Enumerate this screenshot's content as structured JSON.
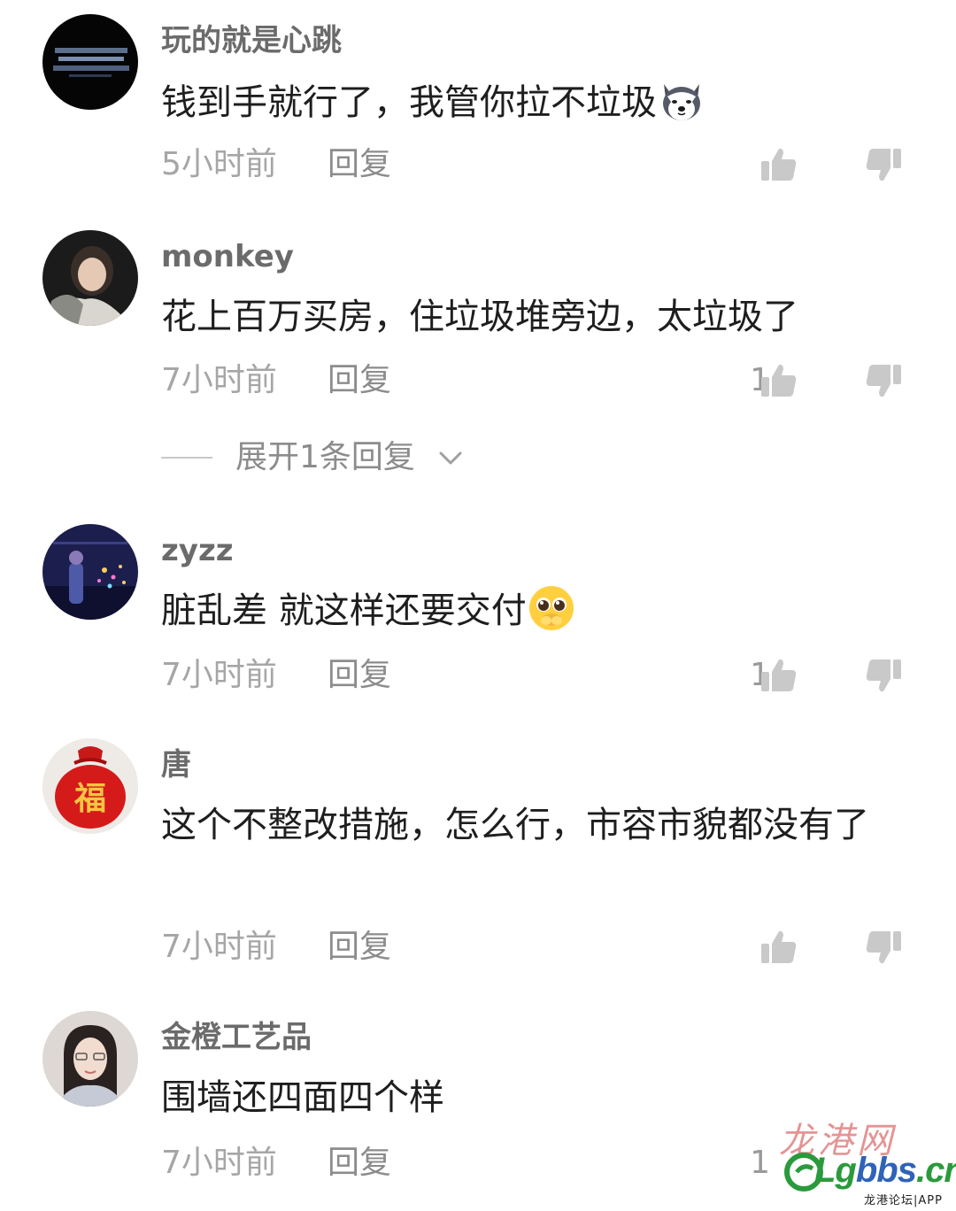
{
  "reply_label": "回复",
  "expand_replies_label": "展开1条回复",
  "comments": [
    {
      "username": "玩的就是心跳",
      "text": "钱到手就行了，我管你拉不垃圾",
      "emoji": "husky-dog-emoji",
      "time": "5小时前",
      "likes": "",
      "avatar": "dark-text-banner-avatar"
    },
    {
      "username": "monkey",
      "text": "花上百万买房，住垃圾堆旁边，太垃圾了",
      "emoji": "",
      "time": "7小时前",
      "likes": "1",
      "avatar": "girl-photo-avatar"
    },
    {
      "username": "zyzz",
      "text": "脏乱差 就这样还要交付",
      "emoji": "pleading-face-emoji",
      "time": "7小时前",
      "likes": "1",
      "avatar": "night-lights-avatar"
    },
    {
      "username": "唐",
      "text": "这个不整改措施，怎么行，市容市貌都没有了",
      "emoji": "",
      "time": "7小时前",
      "likes": "",
      "avatar": "red-fu-bag-avatar"
    },
    {
      "username": "金橙工艺品",
      "text": "围墙还四面四个样",
      "emoji": "",
      "time": "7小时前",
      "likes": "1",
      "avatar": "woman-portrait-avatar"
    }
  ],
  "watermark": {
    "script": "龙港网",
    "domain_prefix": "Lg",
    "domain_main": "bbs",
    "domain_suffix": ".cn",
    "tagline": "龙港论坛|APP"
  },
  "colors": {
    "username": "#6b6b6b",
    "text": "#1e1e1e",
    "meta": "#a6a6a6",
    "icon": "#c9c9c9",
    "watermark_green": "#2a9a3c",
    "watermark_red": "#cd3c3c"
  }
}
